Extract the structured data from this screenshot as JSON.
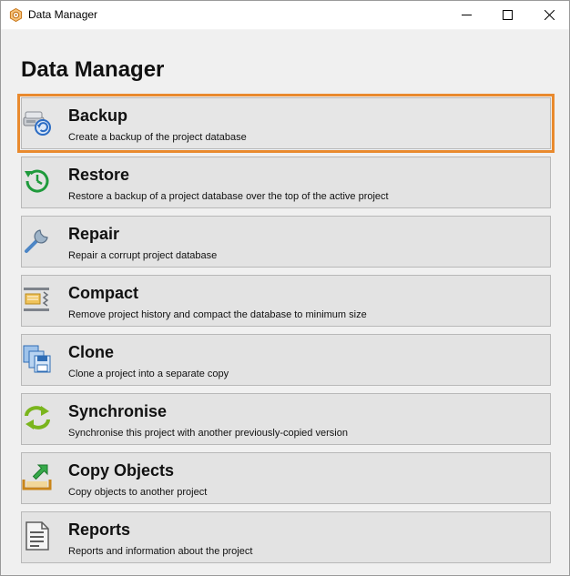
{
  "window": {
    "title": "Data Manager"
  },
  "page": {
    "heading": "Data Manager"
  },
  "items": [
    {
      "title": "Backup",
      "description": "Create a backup of the project database",
      "icon": "backup-icon",
      "selected": true
    },
    {
      "title": "Restore",
      "description": "Restore a backup of a project database over the top of the active project",
      "icon": "restore-icon"
    },
    {
      "title": "Repair",
      "description": "Repair a corrupt project database",
      "icon": "repair-icon"
    },
    {
      "title": "Compact",
      "description": "Remove project history and compact the database to minimum size",
      "icon": "compact-icon"
    },
    {
      "title": "Clone",
      "description": "Clone a project into a separate copy",
      "icon": "clone-icon"
    },
    {
      "title": "Synchronise",
      "description": "Synchronise this project with another previously-copied version",
      "icon": "synchronise-icon"
    },
    {
      "title": "Copy Objects",
      "description": "Copy objects to another project",
      "icon": "copy-objects-icon"
    },
    {
      "title": "Reports",
      "description": "Reports and information about the project",
      "icon": "reports-icon"
    }
  ],
  "colors": {
    "selection_outline": "#e98a2e",
    "item_background": "#e3e3e3",
    "window_background": "#f0f0f0"
  }
}
